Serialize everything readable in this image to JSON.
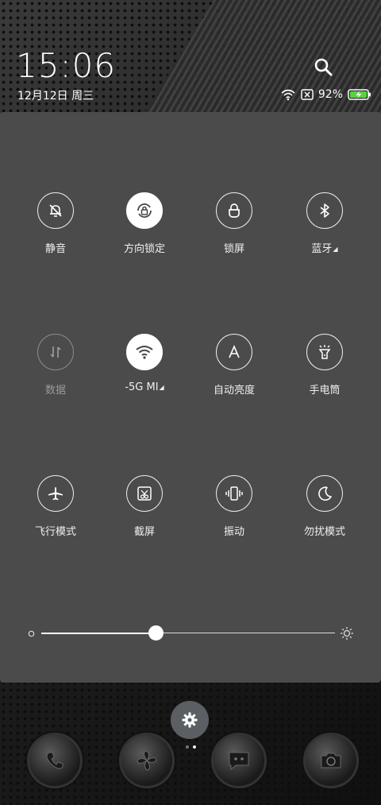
{
  "status": {
    "time": "15:06",
    "date": "12月12日 周三",
    "battery": "92%"
  },
  "tiles": [
    {
      "label": "静音",
      "icon": "bell-off-icon",
      "state": "off-outline"
    },
    {
      "label": "方向锁定",
      "icon": "rotation-lock-icon",
      "state": "on"
    },
    {
      "label": "锁屏",
      "icon": "lock-icon",
      "state": "off-outline"
    },
    {
      "label": "蓝牙",
      "icon": "bluetooth-icon",
      "state": "off-outline",
      "expand": "◢"
    },
    {
      "label": "数据",
      "icon": "mobile-data-icon",
      "state": "disabled"
    },
    {
      "label": "-5G MI",
      "icon": "wifi-icon",
      "state": "on",
      "expand": "◢"
    },
    {
      "label": "自动亮度",
      "icon": "auto-brightness-icon",
      "state": "off-outline"
    },
    {
      "label": "手电筒",
      "icon": "flashlight-icon",
      "state": "off-outline"
    },
    {
      "label": "飞行模式",
      "icon": "airplane-icon",
      "state": "off-outline"
    },
    {
      "label": "截屏",
      "icon": "screenshot-icon",
      "state": "off-outline"
    },
    {
      "label": "振动",
      "icon": "vibrate-icon",
      "state": "off-outline"
    },
    {
      "label": "勿扰模式",
      "icon": "moon-icon",
      "state": "off-outline"
    }
  ],
  "brightness": {
    "level": 0.39
  },
  "dock": {
    "apps": [
      "phone-icon",
      "app-icon",
      "messages-icon",
      "camera-icon"
    ],
    "page": 2,
    "pages": 2
  }
}
